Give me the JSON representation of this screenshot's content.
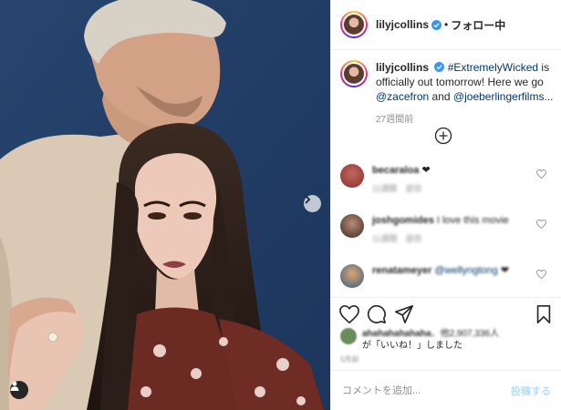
{
  "post": {
    "username": "lilyjcollins",
    "follow_label": "フォロー中",
    "separator": "•"
  },
  "caption": {
    "username": "lilyjcollins",
    "hashtag": "#ExtremelyWicked",
    "text_1": " is officially out tomorrow! Here we go ",
    "mention_1": "@zacefron",
    "text_2": " and ",
    "mention_2": "@joeberlingerfilms...",
    "time": "27週間前"
  },
  "comments": [
    {
      "username": "becaraloa",
      "text": "❤",
      "meta": "11週間　返信"
    },
    {
      "username": "joshgomides",
      "text": "I love this movie",
      "meta": "11週間　返信"
    },
    {
      "username": "renatameyer",
      "text": "@wellyngtong",
      "extra": "❤"
    }
  ],
  "likes": {
    "username": "ahahahahahaha",
    "text_1": "、他2,907,336人",
    "text_2": "が「いいね！」しました"
  },
  "post_date": "5月前",
  "add_comment": {
    "placeholder": "コメントを追加...",
    "post_label": "投稿する"
  },
  "colors": {
    "accent_link": "#00376b",
    "muted": "#8e8e8e",
    "verified": "#3897f0",
    "post_disabled": "#b2dffc",
    "photo_background": "#1f3a63"
  },
  "icons": [
    "chevron-right-icon",
    "user-tag-icon",
    "verified-icon",
    "plus-circle-icon",
    "heart-icon",
    "comment-icon",
    "share-icon",
    "bookmark-icon"
  ]
}
